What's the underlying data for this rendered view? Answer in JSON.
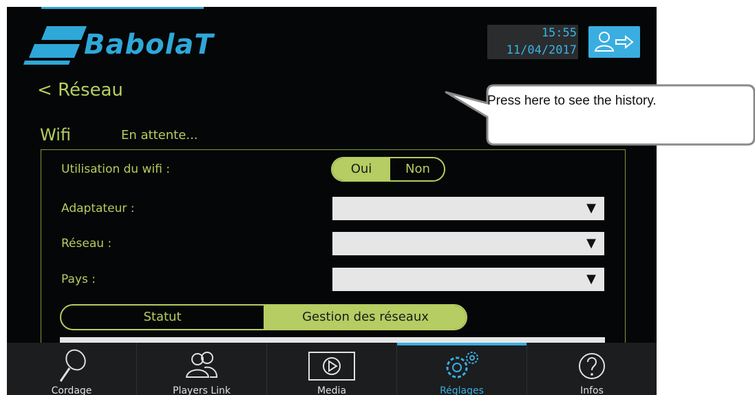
{
  "header": {
    "logo_text": "BabolaT",
    "time": "15:55",
    "date": "11/04/2017",
    "logout_icon": "user-exit-icon",
    "accent_color": "#3aaee0"
  },
  "page": {
    "back_label": "< Réseau",
    "section_title": "Wifi",
    "wifi_status": "En attente..."
  },
  "form": {
    "wifi_label": "Utilisation du wifi :",
    "toggle_on": "Oui",
    "toggle_off": "Non",
    "toggle_selected": "Oui",
    "adapter_label": "Adaptateur :",
    "network_label": "Réseau :",
    "country_label": "Pays :",
    "adapter_value": "",
    "network_value": "",
    "country_value": "",
    "dropdown_arrow": "▼",
    "accent_color": "#b5cd62"
  },
  "subtabs": {
    "status": "Statut",
    "manage": "Gestion des réseaux",
    "selected": "Gestion des réseaux"
  },
  "nav": {
    "items": [
      {
        "label": "Cordage",
        "icon": "racket-icon"
      },
      {
        "label": "Players Link",
        "icon": "players-icon"
      },
      {
        "label": "Media",
        "icon": "play-icon"
      },
      {
        "label": "Réglages",
        "icon": "gears-icon"
      },
      {
        "label": "Infos",
        "icon": "help-icon"
      }
    ],
    "active": "Réglages"
  },
  "callout": {
    "text": "Press here to see the history."
  }
}
